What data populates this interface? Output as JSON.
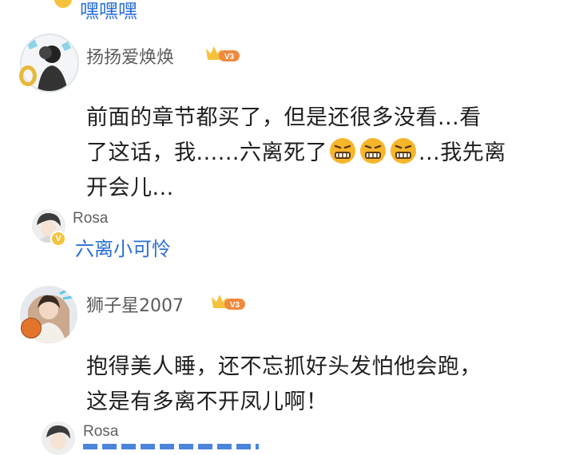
{
  "comments": [
    {
      "username": "扬扬爱焕焕",
      "level_badge": "V3",
      "body_lines": [
        "前面的章节都买了，但是还很多没看...看",
        "了这话，我......六离死了",
        "...我先离",
        "开会儿..."
      ],
      "emoji": "grimacing-emoji",
      "reply": {
        "username": "Rosa",
        "text": "六离小可怜"
      }
    },
    {
      "username": "狮子星2007",
      "level_badge": "V3",
      "body_lines": [
        "抱得美人睡，还不忘抓好头发怕他会跑，",
        "这是有多离不开凤儿啊！"
      ],
      "reply": {
        "username": "Rosa"
      }
    }
  ],
  "top_reply": {
    "text": "嘿嘿嘿"
  },
  "colors": {
    "reply_blue": "#2a6fd6",
    "badge_gold": "#f4c23c",
    "badge_orange": "#f08a3e"
  }
}
